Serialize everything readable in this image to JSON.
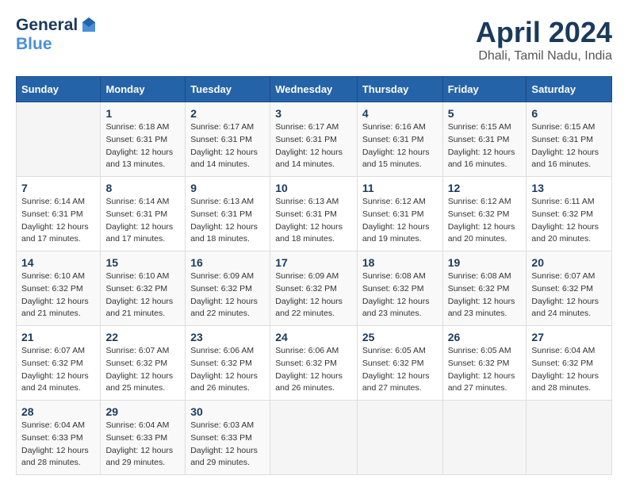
{
  "logo": {
    "line1": "General",
    "line2": "Blue"
  },
  "title": "April 2024",
  "subtitle": "Dhali, Tamil Nadu, India",
  "headers": [
    "Sunday",
    "Monday",
    "Tuesday",
    "Wednesday",
    "Thursday",
    "Friday",
    "Saturday"
  ],
  "weeks": [
    [
      {
        "day": "",
        "sunrise": "",
        "sunset": "",
        "daylight": ""
      },
      {
        "day": "1",
        "sunrise": "Sunrise: 6:18 AM",
        "sunset": "Sunset: 6:31 PM",
        "daylight": "Daylight: 12 hours and 13 minutes."
      },
      {
        "day": "2",
        "sunrise": "Sunrise: 6:17 AM",
        "sunset": "Sunset: 6:31 PM",
        "daylight": "Daylight: 12 hours and 14 minutes."
      },
      {
        "day": "3",
        "sunrise": "Sunrise: 6:17 AM",
        "sunset": "Sunset: 6:31 PM",
        "daylight": "Daylight: 12 hours and 14 minutes."
      },
      {
        "day": "4",
        "sunrise": "Sunrise: 6:16 AM",
        "sunset": "Sunset: 6:31 PM",
        "daylight": "Daylight: 12 hours and 15 minutes."
      },
      {
        "day": "5",
        "sunrise": "Sunrise: 6:15 AM",
        "sunset": "Sunset: 6:31 PM",
        "daylight": "Daylight: 12 hours and 16 minutes."
      },
      {
        "day": "6",
        "sunrise": "Sunrise: 6:15 AM",
        "sunset": "Sunset: 6:31 PM",
        "daylight": "Daylight: 12 hours and 16 minutes."
      }
    ],
    [
      {
        "day": "7",
        "sunrise": "Sunrise: 6:14 AM",
        "sunset": "Sunset: 6:31 PM",
        "daylight": "Daylight: 12 hours and 17 minutes."
      },
      {
        "day": "8",
        "sunrise": "Sunrise: 6:14 AM",
        "sunset": "Sunset: 6:31 PM",
        "daylight": "Daylight: 12 hours and 17 minutes."
      },
      {
        "day": "9",
        "sunrise": "Sunrise: 6:13 AM",
        "sunset": "Sunset: 6:31 PM",
        "daylight": "Daylight: 12 hours and 18 minutes."
      },
      {
        "day": "10",
        "sunrise": "Sunrise: 6:13 AM",
        "sunset": "Sunset: 6:31 PM",
        "daylight": "Daylight: 12 hours and 18 minutes."
      },
      {
        "day": "11",
        "sunrise": "Sunrise: 6:12 AM",
        "sunset": "Sunset: 6:31 PM",
        "daylight": "Daylight: 12 hours and 19 minutes."
      },
      {
        "day": "12",
        "sunrise": "Sunrise: 6:12 AM",
        "sunset": "Sunset: 6:32 PM",
        "daylight": "Daylight: 12 hours and 20 minutes."
      },
      {
        "day": "13",
        "sunrise": "Sunrise: 6:11 AM",
        "sunset": "Sunset: 6:32 PM",
        "daylight": "Daylight: 12 hours and 20 minutes."
      }
    ],
    [
      {
        "day": "14",
        "sunrise": "Sunrise: 6:10 AM",
        "sunset": "Sunset: 6:32 PM",
        "daylight": "Daylight: 12 hours and 21 minutes."
      },
      {
        "day": "15",
        "sunrise": "Sunrise: 6:10 AM",
        "sunset": "Sunset: 6:32 PM",
        "daylight": "Daylight: 12 hours and 21 minutes."
      },
      {
        "day": "16",
        "sunrise": "Sunrise: 6:09 AM",
        "sunset": "Sunset: 6:32 PM",
        "daylight": "Daylight: 12 hours and 22 minutes."
      },
      {
        "day": "17",
        "sunrise": "Sunrise: 6:09 AM",
        "sunset": "Sunset: 6:32 PM",
        "daylight": "Daylight: 12 hours and 22 minutes."
      },
      {
        "day": "18",
        "sunrise": "Sunrise: 6:08 AM",
        "sunset": "Sunset: 6:32 PM",
        "daylight": "Daylight: 12 hours and 23 minutes."
      },
      {
        "day": "19",
        "sunrise": "Sunrise: 6:08 AM",
        "sunset": "Sunset: 6:32 PM",
        "daylight": "Daylight: 12 hours and 23 minutes."
      },
      {
        "day": "20",
        "sunrise": "Sunrise: 6:07 AM",
        "sunset": "Sunset: 6:32 PM",
        "daylight": "Daylight: 12 hours and 24 minutes."
      }
    ],
    [
      {
        "day": "21",
        "sunrise": "Sunrise: 6:07 AM",
        "sunset": "Sunset: 6:32 PM",
        "daylight": "Daylight: 12 hours and 24 minutes."
      },
      {
        "day": "22",
        "sunrise": "Sunrise: 6:07 AM",
        "sunset": "Sunset: 6:32 PM",
        "daylight": "Daylight: 12 hours and 25 minutes."
      },
      {
        "day": "23",
        "sunrise": "Sunrise: 6:06 AM",
        "sunset": "Sunset: 6:32 PM",
        "daylight": "Daylight: 12 hours and 26 minutes."
      },
      {
        "day": "24",
        "sunrise": "Sunrise: 6:06 AM",
        "sunset": "Sunset: 6:32 PM",
        "daylight": "Daylight: 12 hours and 26 minutes."
      },
      {
        "day": "25",
        "sunrise": "Sunrise: 6:05 AM",
        "sunset": "Sunset: 6:32 PM",
        "daylight": "Daylight: 12 hours and 27 minutes."
      },
      {
        "day": "26",
        "sunrise": "Sunrise: 6:05 AM",
        "sunset": "Sunset: 6:32 PM",
        "daylight": "Daylight: 12 hours and 27 minutes."
      },
      {
        "day": "27",
        "sunrise": "Sunrise: 6:04 AM",
        "sunset": "Sunset: 6:32 PM",
        "daylight": "Daylight: 12 hours and 28 minutes."
      }
    ],
    [
      {
        "day": "28",
        "sunrise": "Sunrise: 6:04 AM",
        "sunset": "Sunset: 6:33 PM",
        "daylight": "Daylight: 12 hours and 28 minutes."
      },
      {
        "day": "29",
        "sunrise": "Sunrise: 6:04 AM",
        "sunset": "Sunset: 6:33 PM",
        "daylight": "Daylight: 12 hours and 29 minutes."
      },
      {
        "day": "30",
        "sunrise": "Sunrise: 6:03 AM",
        "sunset": "Sunset: 6:33 PM",
        "daylight": "Daylight: 12 hours and 29 minutes."
      },
      {
        "day": "",
        "sunrise": "",
        "sunset": "",
        "daylight": ""
      },
      {
        "day": "",
        "sunrise": "",
        "sunset": "",
        "daylight": ""
      },
      {
        "day": "",
        "sunrise": "",
        "sunset": "",
        "daylight": ""
      },
      {
        "day": "",
        "sunrise": "",
        "sunset": "",
        "daylight": ""
      }
    ]
  ]
}
